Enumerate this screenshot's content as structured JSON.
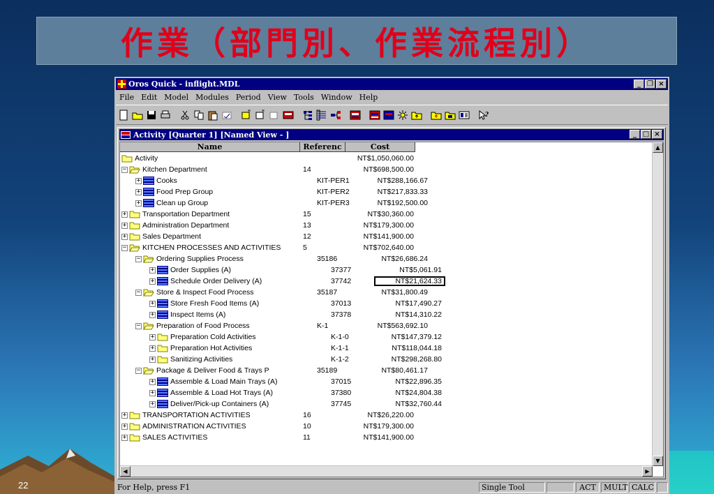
{
  "slide": {
    "title": "作業（部門別、作業流程別）",
    "number": "22"
  },
  "app": {
    "title": "Oros Quick - inflight.MDL",
    "menu": [
      "File",
      "Edit",
      "Model",
      "Modules",
      "Period",
      "View",
      "Tools",
      "Window",
      "Help"
    ],
    "toolbar_icons": [
      "new-icon",
      "open-icon",
      "save-icon",
      "print-icon",
      "cut-icon",
      "copy-icon",
      "paste-icon",
      "undo-icon",
      "new-child-icon",
      "new-sibling-icon",
      "delete-icon",
      "calculator-icon",
      "tree-icon",
      "list-icon",
      "link-icon",
      "grid-view-icon",
      "grid-view2-icon",
      "grid-view3-icon",
      "sun-icon",
      "folder-up-icon",
      "folder-up2-icon",
      "folder-in-icon",
      "report-icon",
      "help-pointer-icon"
    ]
  },
  "child": {
    "title": "Activity [Quarter 1] [Named View - ]",
    "columns": [
      "Name",
      "Referenc",
      "Cost"
    ],
    "rows": [
      {
        "level": 0,
        "exp": "",
        "icon": "folder",
        "name": "Activity",
        "ref": "",
        "cost": "NT$1,050,060.00"
      },
      {
        "level": 0,
        "exp": "−",
        "icon": "folder-open",
        "name": "Kitchen Department",
        "ref": "14",
        "cost": "NT$698,500.00"
      },
      {
        "level": 1,
        "exp": "+",
        "icon": "resource",
        "name": "Cooks",
        "ref": "KIT-PER1",
        "cost": "NT$288,166.67"
      },
      {
        "level": 1,
        "exp": "+",
        "icon": "resource",
        "name": "Food Prep Group",
        "ref": "KIT-PER2",
        "cost": "NT$217,833.33"
      },
      {
        "level": 1,
        "exp": "+",
        "icon": "resource",
        "name": "Clean up Group",
        "ref": "KIT-PER3",
        "cost": "NT$192,500.00"
      },
      {
        "level": 0,
        "exp": "+",
        "icon": "folder",
        "name": "Transportation Department",
        "ref": "15",
        "cost": "NT$30,360.00"
      },
      {
        "level": 0,
        "exp": "+",
        "icon": "folder",
        "name": "Administration Department",
        "ref": "13",
        "cost": "NT$179,300.00"
      },
      {
        "level": 0,
        "exp": "+",
        "icon": "folder",
        "name": "Sales Department",
        "ref": "12",
        "cost": "NT$141,900.00"
      },
      {
        "level": 0,
        "exp": "−",
        "icon": "folder-open",
        "name": "KITCHEN PROCESSES AND ACTIVITIES",
        "ref": "5",
        "cost": "NT$702,640.00"
      },
      {
        "level": 1,
        "exp": "−",
        "icon": "folder-open",
        "name": "Ordering Supplies Process",
        "ref": "35186",
        "cost": "NT$26,686.24"
      },
      {
        "level": 2,
        "exp": "+",
        "icon": "resource",
        "name": "Order Supplies (A)",
        "ref": "37377",
        "cost": "NT$5,061.91"
      },
      {
        "level": 2,
        "exp": "+",
        "icon": "resource",
        "name": "Schedule Order Delivery (A)",
        "ref": "37742",
        "cost": "NT$21,624.33",
        "selected": true
      },
      {
        "level": 1,
        "exp": "−",
        "icon": "folder-open",
        "name": "Store & Inspect Food Process",
        "ref": "35187",
        "cost": "NT$31,800.49"
      },
      {
        "level": 2,
        "exp": "+",
        "icon": "resource",
        "name": "Store Fresh Food Items (A)",
        "ref": "37013",
        "cost": "NT$17,490.27"
      },
      {
        "level": 2,
        "exp": "+",
        "icon": "resource",
        "name": "Inspect Items (A)",
        "ref": "37378",
        "cost": "NT$14,310.22"
      },
      {
        "level": 1,
        "exp": "−",
        "icon": "folder-open",
        "name": "Preparation of Food Process",
        "ref": "K-1",
        "cost": "NT$563,692.10"
      },
      {
        "level": 2,
        "exp": "+",
        "icon": "folder",
        "name": "Preparation Cold Activities",
        "ref": "K-1-0",
        "cost": "NT$147,379.12"
      },
      {
        "level": 2,
        "exp": "+",
        "icon": "folder",
        "name": "Preparation Hot Activities",
        "ref": "K-1-1",
        "cost": "NT$118,044.18"
      },
      {
        "level": 2,
        "exp": "+",
        "icon": "folder",
        "name": "Sanitizing Activities",
        "ref": "K-1-2",
        "cost": "NT$298,268.80"
      },
      {
        "level": 1,
        "exp": "−",
        "icon": "folder-open",
        "name": "Package & Deliver Food & Trays P",
        "ref": "35189",
        "cost": "NT$80,461.17"
      },
      {
        "level": 2,
        "exp": "+",
        "icon": "resource",
        "name": "Assemble & Load Main Trays (A)",
        "ref": "37015",
        "cost": "NT$22,896.35"
      },
      {
        "level": 2,
        "exp": "+",
        "icon": "resource",
        "name": "Assemble & Load Hot Trays (A)",
        "ref": "37380",
        "cost": "NT$24,804.38"
      },
      {
        "level": 2,
        "exp": "+",
        "icon": "resource",
        "name": "Deliver/Pick-up Containers (A)",
        "ref": "37745",
        "cost": "NT$32,760.44"
      },
      {
        "level": 0,
        "exp": "+",
        "icon": "folder",
        "name": "TRANSPORTATION ACTIVITIES",
        "ref": "16",
        "cost": "NT$26,220.00"
      },
      {
        "level": 0,
        "exp": "+",
        "icon": "folder",
        "name": "ADMINISTRATION ACTIVITIES",
        "ref": "10",
        "cost": "NT$179,300.00"
      },
      {
        "level": 0,
        "exp": "+",
        "icon": "folder",
        "name": "SALES ACTIVITIES",
        "ref": "11",
        "cost": "NT$141,900.00"
      }
    ]
  },
  "status": {
    "help": "For Help, press F1",
    "mode": "Single Tool",
    "act": "ACT",
    "mult": "MULT",
    "calc": "CALC"
  },
  "colors": {
    "title_red": "#e0001a",
    "window_blue": "#000080",
    "folder_yellow": "#ffff80"
  }
}
